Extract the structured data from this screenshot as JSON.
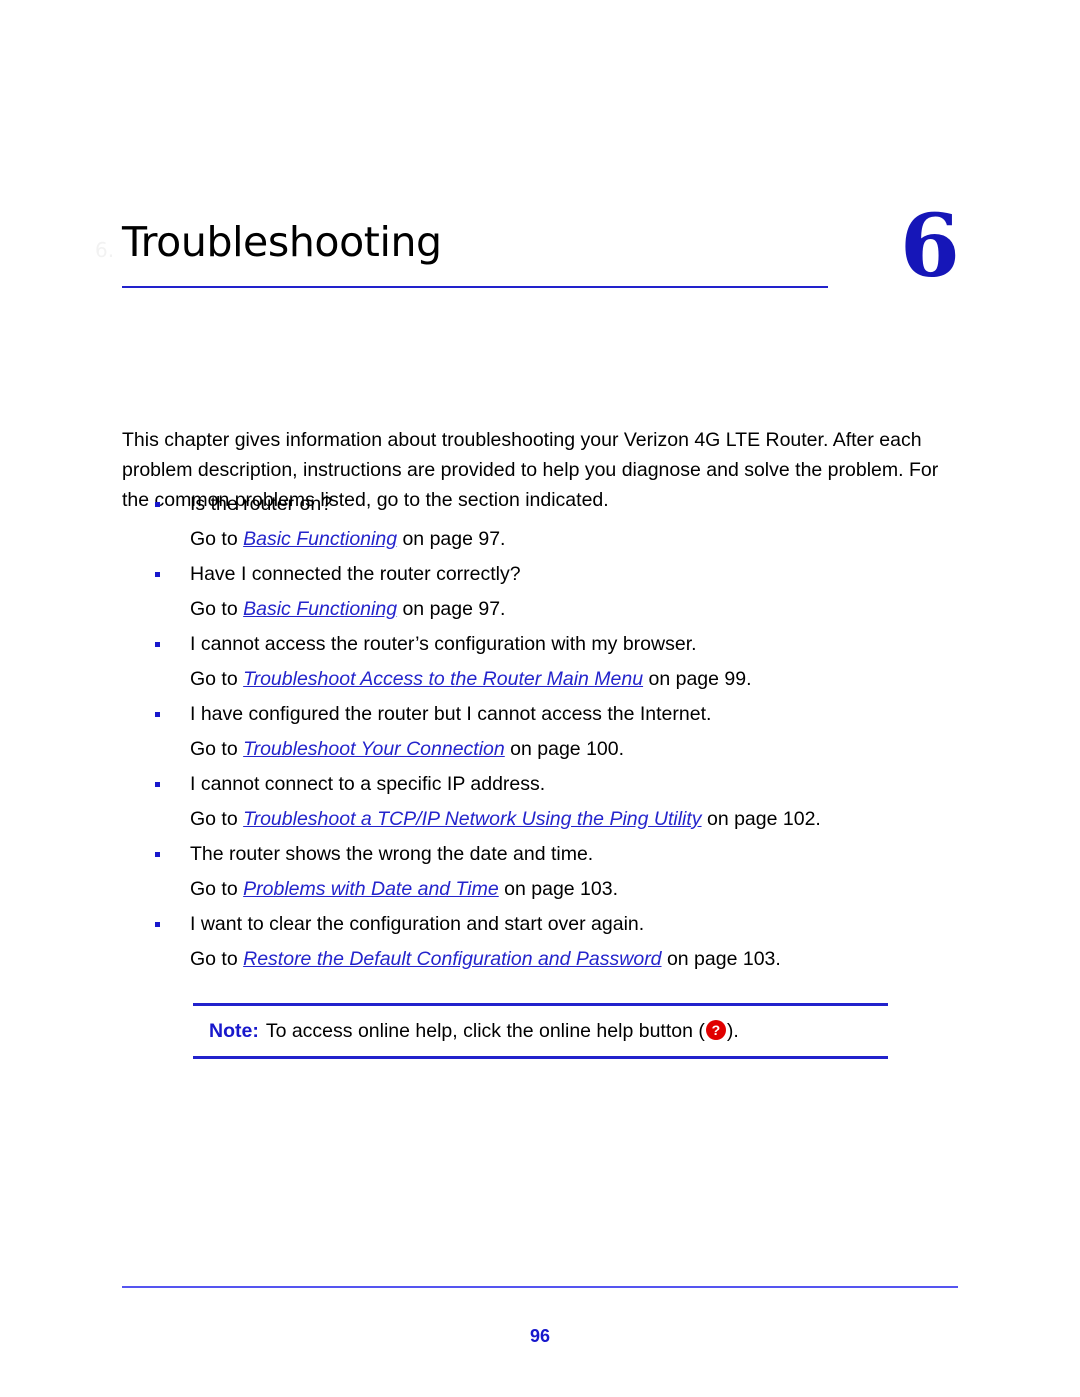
{
  "chapter": {
    "title": "Troubleshooting",
    "number": "6",
    "margin_watermark": "6."
  },
  "intro_paragraph": "This chapter gives information about troubleshooting your Verizon 4G LTE Router. After each problem description, instructions are provided to help you diagnose and solve the problem. For the common problems listed, go to the section indicated.",
  "problems": [
    {
      "question": "Is the router on?",
      "goto_prefix": "Go to ",
      "xref": "Basic Functioning",
      "goto_suffix": " on page 97."
    },
    {
      "question": "Have I connected the router correctly?",
      "goto_prefix": "Go to ",
      "xref": "Basic Functioning",
      "goto_suffix": " on page 97."
    },
    {
      "question": "I cannot access the router’s configuration with my browser.",
      "goto_prefix": "Go to ",
      "xref": "Troubleshoot Access to the Router Main Menu",
      "goto_suffix": " on page 99."
    },
    {
      "question": "I have configured the router but I cannot access the Internet.",
      "goto_prefix": "Go to ",
      "xref": "Troubleshoot Your Connection",
      "goto_suffix": " on page 100."
    },
    {
      "question": "I cannot connect to a specific IP address.",
      "goto_prefix": "Go to ",
      "xref": "Troubleshoot a TCP/IP Network Using the Ping Utility",
      "goto_suffix": " on page 102."
    },
    {
      "question": "The router shows the wrong the date and time.",
      "goto_prefix": "Go to ",
      "xref": "Problems with Date and Time",
      "goto_suffix": " on page 103."
    },
    {
      "question": "I want to clear the configuration and start over again.",
      "goto_prefix": "Go to ",
      "xref": "Restore the Default Configuration and Password",
      "goto_suffix": " on page 103."
    }
  ],
  "note": {
    "label": "Note:",
    "text_before": "To access online help, click the online help button (",
    "help_glyph": "?",
    "text_after": ")."
  },
  "footer": {
    "page_number": "96"
  },
  "colors": {
    "link_blue": "#2424cc",
    "rule_blue": "#2222cc",
    "footer_rule_blue": "#5555f0",
    "chapter_number_blue": "#1616b8",
    "help_button_red": "#e00000",
    "body_text": "#000000"
  }
}
